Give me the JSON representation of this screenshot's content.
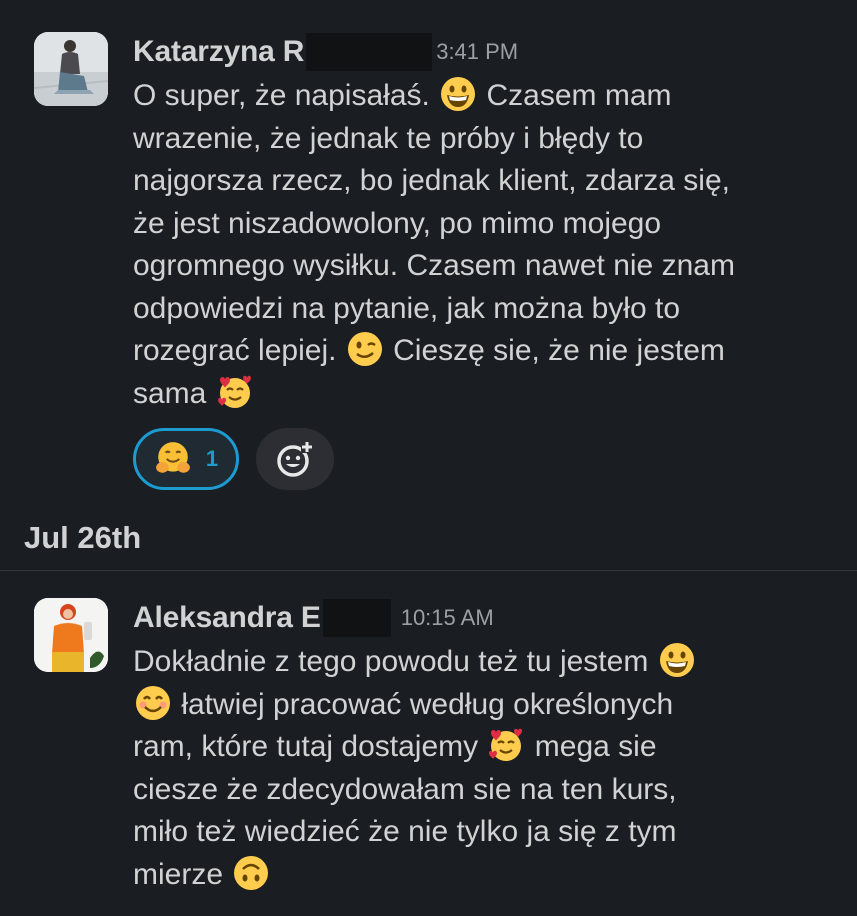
{
  "messages": [
    {
      "author": "Katarzyna R",
      "time": "3:41 PM",
      "lines": [
        [
          "O super, że napisałaś. ",
          "emoji:grin",
          " Czasem mam"
        ],
        [
          "wrazenie, że jednak te próby i błędy to"
        ],
        [
          "najgorsza rzecz, bo jednak klient, zdarza się,"
        ],
        [
          "że jest niszadowolony, po mimo mojego"
        ],
        [
          "ogromnego wysiłku. Czasem nawet nie znam"
        ],
        [
          "odpowiedzi na pytanie, jak można było to"
        ],
        [
          "rozegrać lepiej. ",
          "emoji:wink",
          " Cieszę sie, że nie jestem"
        ],
        [
          "sama ",
          "emoji:smiling-hearts"
        ]
      ],
      "reactions": [
        {
          "emoji": "hugging-face-icon",
          "count": "1"
        }
      ]
    },
    {
      "author": "Aleksandra E",
      "time": "10:15 AM",
      "lines": [
        [
          "Dokładnie z tego powodu też tu jestem ",
          "emoji:grin"
        ],
        [
          "emoji:smile",
          " łatwiej pracować według określonych"
        ],
        [
          "ram, które tutaj dostajemy ",
          "emoji:smiling-hearts",
          " mega sie"
        ],
        [
          "ciesze że zdecydowałam sie na ten kurs,"
        ],
        [
          "miło też wiedzieć że nie tylko ja się z tym"
        ],
        [
          "mierze ",
          "emoji:upside-down"
        ]
      ]
    }
  ],
  "date_divider": "Jul 26th",
  "colors": {
    "background": "#1a1d21",
    "text": "#d1d2d3",
    "timestamp": "#9ca0a4",
    "reaction_accent": "#1d9bd1"
  }
}
